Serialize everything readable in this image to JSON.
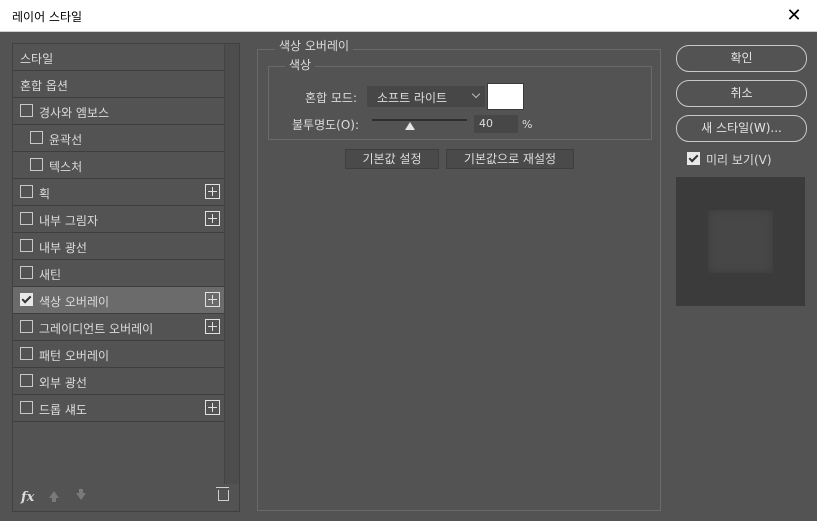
{
  "window": {
    "title": "레이어 스타일",
    "close_glyph": "✕"
  },
  "styles": [
    {
      "label": "스타일",
      "checkbox": false,
      "checked": false,
      "plus": false,
      "indent": false,
      "selected": false
    },
    {
      "label": "혼합 옵션",
      "checkbox": false,
      "checked": false,
      "plus": false,
      "indent": false,
      "selected": false
    },
    {
      "label": "경사와 엠보스",
      "checkbox": true,
      "checked": false,
      "plus": false,
      "indent": false,
      "selected": false
    },
    {
      "label": "윤곽선",
      "checkbox": true,
      "checked": false,
      "plus": false,
      "indent": true,
      "selected": false
    },
    {
      "label": "텍스처",
      "checkbox": true,
      "checked": false,
      "plus": false,
      "indent": true,
      "selected": false
    },
    {
      "label": "획",
      "checkbox": true,
      "checked": false,
      "plus": true,
      "indent": false,
      "selected": false
    },
    {
      "label": "내부 그림자",
      "checkbox": true,
      "checked": false,
      "plus": true,
      "indent": false,
      "selected": false
    },
    {
      "label": "내부 광선",
      "checkbox": true,
      "checked": false,
      "plus": false,
      "indent": false,
      "selected": false
    },
    {
      "label": "새틴",
      "checkbox": true,
      "checked": false,
      "plus": false,
      "indent": false,
      "selected": false
    },
    {
      "label": "색상 오버레이",
      "checkbox": true,
      "checked": true,
      "plus": true,
      "indent": false,
      "selected": true
    },
    {
      "label": "그레이디언트 오버레이",
      "checkbox": true,
      "checked": false,
      "plus": true,
      "indent": false,
      "selected": false
    },
    {
      "label": "패턴 오버레이",
      "checkbox": true,
      "checked": false,
      "plus": false,
      "indent": false,
      "selected": false
    },
    {
      "label": "외부 광선",
      "checkbox": true,
      "checked": false,
      "plus": false,
      "indent": false,
      "selected": false
    },
    {
      "label": "드롭 섀도",
      "checkbox": true,
      "checked": false,
      "plus": true,
      "indent": false,
      "selected": false
    }
  ],
  "bottom_bar": {
    "fx_label": "fx"
  },
  "color_overlay": {
    "group_title": "색상 오버레이",
    "subgroup_title": "색상",
    "blend_mode_label": "혼합 모드:",
    "blend_mode_value": "소프트 라이트",
    "color_swatch": "#ffffff",
    "opacity_label": "불투명도(O):",
    "opacity_value": "40",
    "opacity_fraction": 0.4,
    "opacity_unit": "%",
    "make_default_label": "기본값 설정",
    "reset_default_label": "기본값으로 재설정"
  },
  "actions": {
    "ok_label": "확인",
    "cancel_label": "취소",
    "new_style_label": "새 스타일(W)...",
    "preview_label": "미리 보기(V)",
    "preview_checked": true
  }
}
